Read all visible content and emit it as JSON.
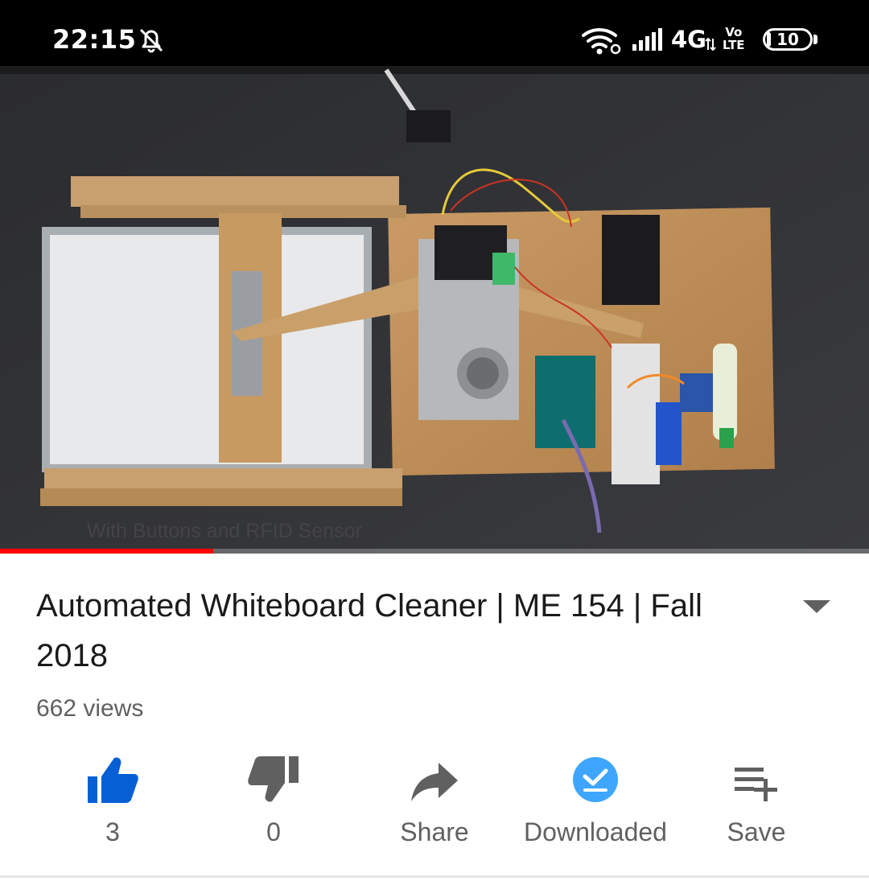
{
  "status_bar": {
    "time": "22:15",
    "network_type": "4G",
    "volte_top": "Vo",
    "volte_bottom": "LTE",
    "battery_level": "10",
    "icons": [
      "alarm-off-icon",
      "wifi-icon",
      "signal-icon",
      "data-arrows-icon",
      "battery-icon"
    ]
  },
  "player": {
    "caption_overlay": "With Buttons and RFID Sensor",
    "progress": 0.245,
    "progress_color": "#ff0000"
  },
  "video": {
    "title": "Automated Whiteboard Cleaner | ME 154 | Fall 2018",
    "views": "662 views",
    "expand_icon": "chevron-down-icon"
  },
  "actions": {
    "like": {
      "count": "3",
      "icon": "thumbs-up-icon",
      "color": "#065fd4"
    },
    "dislike": {
      "count": "0",
      "icon": "thumbs-down-icon",
      "color": "#606060"
    },
    "share": {
      "label": "Share",
      "icon": "share-icon"
    },
    "download": {
      "label": "Downloaded",
      "icon": "downloaded-check-icon",
      "color": "#3ea6ff"
    },
    "save": {
      "label": "Save",
      "icon": "playlist-add-icon"
    }
  },
  "colors": {
    "text_primary": "#1a1a1a",
    "text_secondary": "#606060",
    "status_bar_bg": "#000000"
  }
}
